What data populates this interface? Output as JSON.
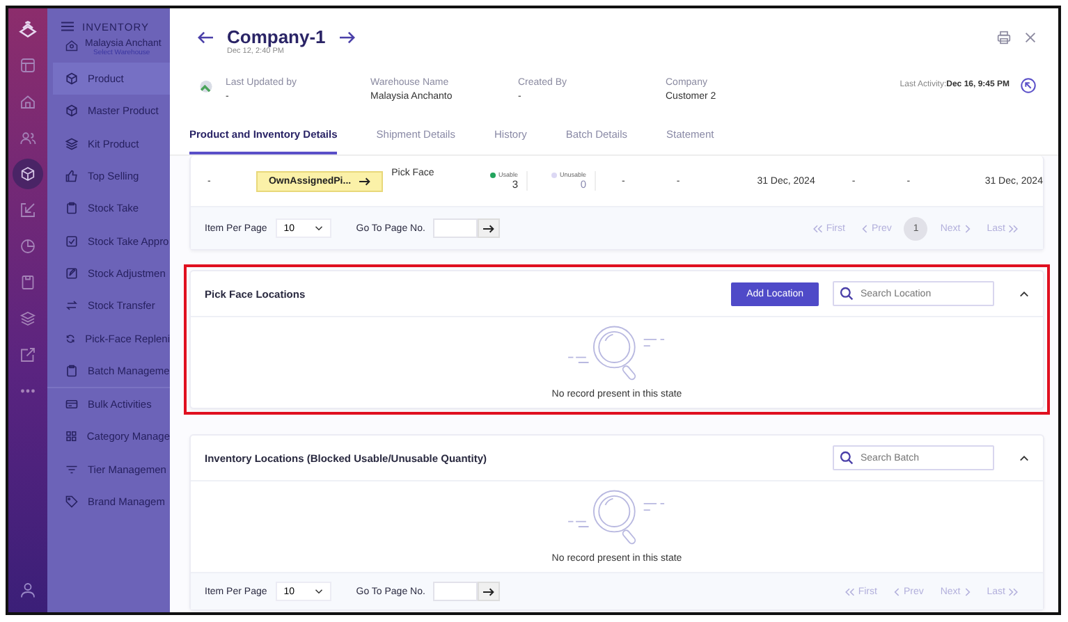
{
  "rail": {
    "items": [
      {
        "selected": false
      },
      {
        "selected": false
      },
      {
        "selected": false
      },
      {
        "selected": true
      },
      {
        "selected": false
      },
      {
        "selected": false
      },
      {
        "selected": false
      },
      {
        "selected": false
      },
      {
        "selected": false
      },
      {
        "selected": false
      }
    ]
  },
  "sidebar": {
    "title": "INVENTORY",
    "warehouse": {
      "name": "Malaysia Anchant",
      "hint": "Select Warehouse"
    },
    "items": [
      {
        "label": "Product",
        "selected": true
      },
      {
        "label": "Master Product",
        "selected": false
      },
      {
        "label": "Kit Product",
        "selected": false
      },
      {
        "label": "Top Selling",
        "selected": false
      },
      {
        "label": "Stock Take",
        "selected": false
      },
      {
        "label": "Stock Take Appro",
        "selected": false
      },
      {
        "label": "Stock Adjustmen",
        "selected": false
      },
      {
        "label": "Stock Transfer",
        "selected": false
      },
      {
        "label": "Pick-Face Repleni",
        "selected": false
      },
      {
        "label": "Batch Manageme",
        "selected": false,
        "divider": true
      },
      {
        "label": "Bulk Activities",
        "selected": false
      },
      {
        "label": "Category Manage",
        "selected": false
      },
      {
        "label": "Tier Managemen",
        "selected": false
      },
      {
        "label": "Brand Managem",
        "selected": false
      }
    ]
  },
  "header": {
    "title": "Company-1",
    "date": "Dec 12, 2:40 PM"
  },
  "info": [
    {
      "label": "Last Updated by",
      "value": "-"
    },
    {
      "label": "Warehouse Name",
      "value": "Malaysia Anchanto"
    },
    {
      "label": "Created By",
      "value": "-"
    },
    {
      "label": "Company",
      "value": "Customer 2"
    }
  ],
  "last_activity": {
    "label": "Last Activity:",
    "value": "Dec 16, 9:45 PM"
  },
  "tabs": [
    {
      "label": "Product and Inventory Details",
      "selected": true
    },
    {
      "label": "Shipment Details",
      "selected": false
    },
    {
      "label": "History",
      "selected": false
    },
    {
      "label": "Batch Details",
      "selected": false
    },
    {
      "label": "Statement",
      "selected": false
    }
  ],
  "table": {
    "row": {
      "col_1": "-",
      "location": "OwnAssignedPi...",
      "type": "Pick Face",
      "usable": {
        "label": "Usable",
        "value": "3",
        "color": "#22a45d"
      },
      "unusable": {
        "label": "Unusable",
        "value": "0",
        "color": "#dcd8f4"
      },
      "cells_a": [
        "-",
        "-",
        "31 Dec, 2024",
        "-",
        "-",
        "31 Dec, 2024"
      ]
    }
  },
  "pagination_1": {
    "per_page_label": "Item Per Page",
    "per_page": "10",
    "goto_label": "Go To Page No.",
    "pages": [
      {
        "label": "First",
        "kind": "first",
        "disabled": true
      },
      {
        "label": "Prev",
        "kind": "prev",
        "disabled": true
      },
      {
        "label": "1",
        "kind": "page",
        "selected": true
      },
      {
        "label": "Next",
        "kind": "next",
        "disabled": true
      },
      {
        "label": "Last",
        "kind": "last",
        "disabled": true
      }
    ]
  },
  "pick_face": {
    "title": "Pick Face Locations",
    "highlighted": true,
    "button": "Add Location",
    "search_placeholder": "Search Location",
    "expanded": true,
    "empty": "No record present in this state"
  },
  "inventory": {
    "title": "Inventory Locations (Blocked Usable/Unusable Quantity)",
    "highlighted": false,
    "search_placeholder": "Search Batch",
    "expanded": true,
    "empty": "No record present in this state"
  },
  "pagination_2": {
    "per_page_label": "Item Per Page",
    "per_page": "10",
    "goto_label": "Go To Page No.",
    "pages": [
      {
        "label": "First",
        "kind": "first",
        "disabled": true
      },
      {
        "label": "Prev",
        "kind": "prev",
        "disabled": true
      },
      {
        "label": "Next",
        "kind": "next",
        "disabled": true
      },
      {
        "label": "Last",
        "kind": "last",
        "disabled": true
      }
    ]
  }
}
